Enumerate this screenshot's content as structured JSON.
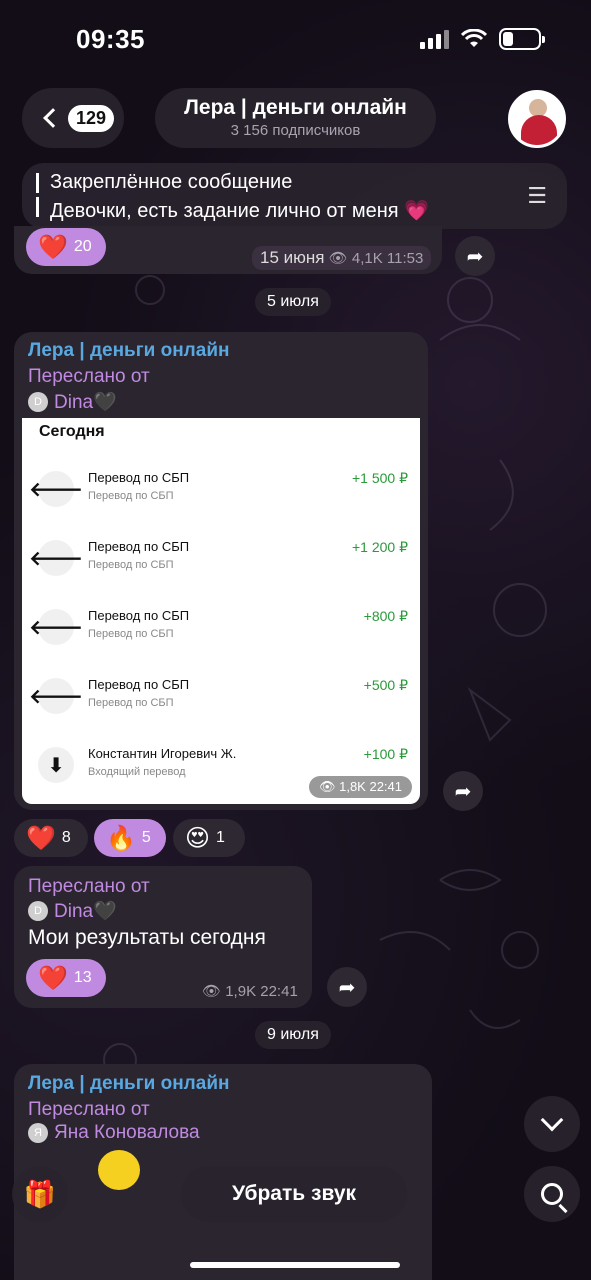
{
  "status": {
    "time": "09:35"
  },
  "header": {
    "back_badge": "129",
    "title": "Лера | деньги онлайн",
    "subtitle": "3 156 подписчиков"
  },
  "pinned": {
    "label": "Закреплённое сообщение",
    "text": "Девочки, есть задание лично от меня 💗"
  },
  "msg1": {
    "reaction": {
      "emoji": "❤️",
      "count": "20"
    },
    "meta_date": "15 июня",
    "meta": "4,1K 11:53"
  },
  "date1": "5 июля",
  "msg2": {
    "channel": "Лера | деньги онлайн",
    "forwarded": "Переслано от",
    "user_initial": "D",
    "user": "Dina🖤",
    "card": {
      "title": "Сегодня",
      "rows": [
        {
          "icon": "🡐",
          "name": "Перевод по СБП",
          "sub": "Перевод по СБП",
          "amount": "+1 500 ₽"
        },
        {
          "icon": "🡐",
          "name": "Перевод по СБП",
          "sub": "Перевод по СБП",
          "amount": "+1 200 ₽"
        },
        {
          "icon": "🡐",
          "name": "Перевод по СБП",
          "sub": "Перевод по СБП",
          "amount": "+800 ₽"
        },
        {
          "icon": "🡐",
          "name": "Перевод по СБП",
          "sub": "Перевод по СБП",
          "amount": "+500 ₽"
        },
        {
          "icon": "⬇",
          "name": "Константин Игоревич Ж.",
          "sub": "Входящий перевод",
          "amount": "+100 ₽"
        }
      ]
    },
    "meta": "1,8K 22:41",
    "reactions": [
      {
        "emoji": "❤️",
        "count": "8"
      },
      {
        "emoji": "🔥",
        "count": "5"
      },
      {
        "emoji": "😍",
        "count": "1"
      }
    ]
  },
  "msg3": {
    "forwarded": "Переслано от",
    "user_initial": "D",
    "user": "Dina🖤",
    "text": "Мои результаты сегодня",
    "reaction": {
      "emoji": "❤️",
      "count": "13"
    },
    "meta": "1,9K 22:41"
  },
  "date2": "9 июля",
  "msg4": {
    "channel": "Лера | деньги онлайн",
    "forwarded": "Переслано от",
    "user_initial": "Я",
    "user": "Яна Коновалова"
  },
  "bottom": {
    "mute": "Убрать звук"
  },
  "colors": {
    "accent_purple": "#c08ae0",
    "channel_blue": "#5aa8e0",
    "income_green": "#2a9a3a"
  }
}
